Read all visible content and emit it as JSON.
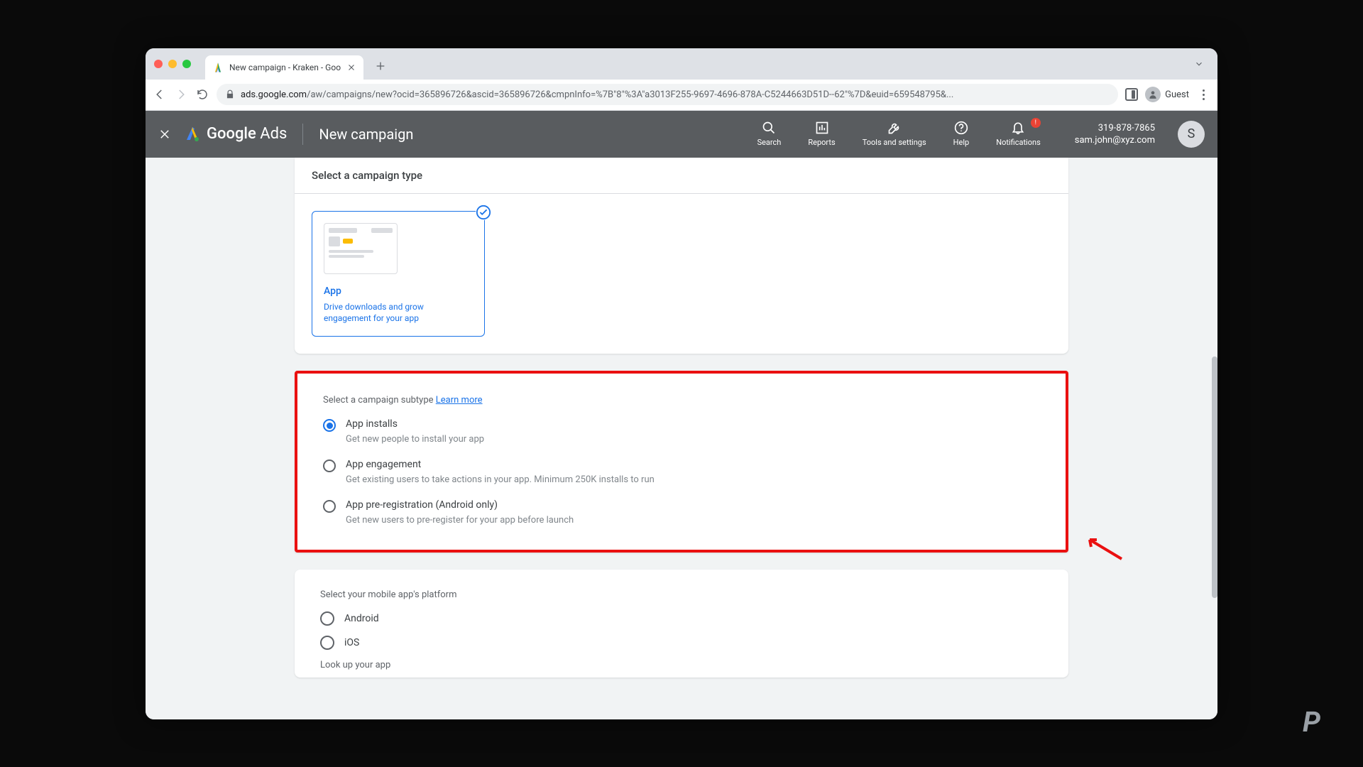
{
  "browser": {
    "tab_title": "New campaign - Kraken - Goo",
    "url_host": "ads.google.com",
    "url_path": "/aw/campaigns/new?ocid=365896726&ascid=365896726&cmpnInfo=%7B\"8\"%3A\"a3013F255-9697-4696-878A-C5244663D51D--62\"%7D&euid=659548795&...",
    "guest_label": "Guest"
  },
  "header": {
    "app_name_1": "Google",
    "app_name_2": "Ads",
    "page_title": "New campaign",
    "icons": {
      "search": "Search",
      "reports": "Reports",
      "tools": "Tools and settings",
      "help": "Help",
      "notifications": "Notifications"
    },
    "notif_count": "!",
    "account_phone": "319-878-7865",
    "account_email": "sam.john@xyz.com",
    "avatar_letter": "S"
  },
  "campaign_type": {
    "section_title": "Select a campaign type",
    "tile_title": "App",
    "tile_desc": "Drive downloads and grow engagement for your app"
  },
  "subtype": {
    "label": "Select a campaign subtype",
    "learn_more": "Learn more",
    "options": [
      {
        "title": "App installs",
        "desc": "Get new people to install your app",
        "selected": true
      },
      {
        "title": "App engagement",
        "desc": "Get existing users to take actions in your app. Minimum 250K installs to run",
        "selected": false
      },
      {
        "title": "App pre-registration (Android only)",
        "desc": "Get new users to pre-register for your app before launch",
        "selected": false
      }
    ]
  },
  "platform": {
    "label": "Select your mobile app's platform",
    "options": [
      "Android",
      "iOS"
    ],
    "lookup_label": "Look up your app"
  }
}
